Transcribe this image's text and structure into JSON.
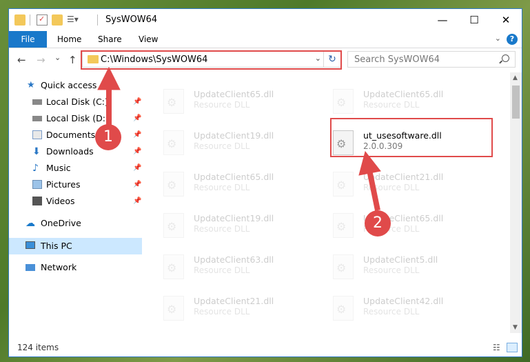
{
  "window": {
    "title": "SysWOW64",
    "minimize_glyph": "—",
    "maximize_glyph": "☐",
    "close_glyph": "✕"
  },
  "ribbon": {
    "tabs": [
      "File",
      "Home",
      "Share",
      "View"
    ],
    "help_glyph": "?"
  },
  "navbar": {
    "back_glyph": "←",
    "forward_glyph": "→",
    "recent_glyph": "⌄",
    "up_glyph": "↑",
    "address": "C:\\Windows\\SysWOW64",
    "search_placeholder": "Search SysWOW64"
  },
  "sidebar": {
    "items": [
      {
        "label": "Quick access",
        "icon": "star-icon"
      },
      {
        "label": "Local Disk (C:)",
        "icon": "drive-icon",
        "pinned": true
      },
      {
        "label": "Local Disk (D:)",
        "icon": "drive-icon",
        "pinned": true
      },
      {
        "label": "Documents",
        "icon": "documents-icon",
        "pinned": true
      },
      {
        "label": "Downloads",
        "icon": "downloads-icon",
        "pinned": true
      },
      {
        "label": "Music",
        "icon": "music-icon",
        "pinned": true
      },
      {
        "label": "Pictures",
        "icon": "pictures-icon",
        "pinned": true
      },
      {
        "label": "Videos",
        "icon": "videos-icon",
        "pinned": true
      },
      {
        "label": "OneDrive",
        "icon": "onedrive-icon"
      },
      {
        "label": "This PC",
        "icon": "pc-icon",
        "selected": true
      },
      {
        "label": "Network",
        "icon": "network-icon"
      }
    ]
  },
  "files": {
    "left": [
      {
        "name": "UpdateClient65.dll",
        "desc": "Resource DLL"
      },
      {
        "name": "UpdateClient19.dll",
        "desc": "Resource DLL"
      },
      {
        "name": "UpdateClient65.dll",
        "desc": "Resource DLL"
      },
      {
        "name": "UpdateClient19.dll",
        "desc": "Resource DLL"
      },
      {
        "name": "UpdateClient63.dll",
        "desc": "Resource DLL"
      },
      {
        "name": "UpdateClient21.dll",
        "desc": "Resource DLL"
      }
    ],
    "right": [
      {
        "name": "UpdateClient65.dll",
        "desc": "Resource DLL"
      },
      {
        "name": "ut_usesoftware.dll",
        "desc": "2.0.0.309",
        "highlighted": true
      },
      {
        "name": "UpdateClient21.dll",
        "desc": "Resource DLL"
      },
      {
        "name": "UpdateClient65.dll",
        "desc": "Resource DLL"
      },
      {
        "name": "UpdateClient5.dll",
        "desc": "Resource DLL"
      },
      {
        "name": "UpdateClient42.dll",
        "desc": "Resource DLL"
      }
    ]
  },
  "status": {
    "item_count": "124 items"
  },
  "annotations": {
    "step1": "1",
    "step2": "2",
    "color": "#e04a4a"
  },
  "colors": {
    "accent": "#1979ca",
    "selected": "#cce8ff",
    "folder": "#f3c85a"
  }
}
